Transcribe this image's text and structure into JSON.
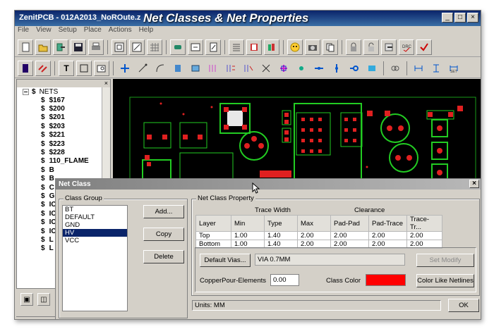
{
  "window": {
    "app_title": "ZenitPCB - 012A2013_NoROute.z",
    "overlay_title": "Net Classes & Net Properties",
    "controls": [
      "_",
      "□",
      "×"
    ]
  },
  "menu": [
    "File",
    "View",
    "Setup",
    "Place",
    "Actions",
    "Help"
  ],
  "sidebar": {
    "close": "×",
    "root_label": "NETS",
    "items": [
      "$167",
      "$200",
      "$201",
      "$203",
      "$221",
      "$223",
      "$228",
      "110_FLAME",
      "B",
      "B",
      "C",
      "G",
      "IC",
      "IC",
      "IC",
      "IC",
      "L",
      "L"
    ]
  },
  "dialog": {
    "title": "Net Class",
    "close": "×",
    "class_group": {
      "label": "Class Group",
      "items": [
        "BT",
        "DEFAULT",
        "GND",
        "HV",
        "VCC"
      ],
      "selected": "HV",
      "add_label": "Add...",
      "copy_label": "Copy",
      "delete_label": "Delete"
    },
    "property": {
      "label": "Net Class Property",
      "trace_width_label": "Trace Width",
      "clearance_label": "Clearance",
      "columns": [
        "Layer",
        "Min",
        "Type",
        "Max",
        "Pad-Pad",
        "Pad-Trace",
        "Trace-Tr..."
      ],
      "rows": [
        [
          "Top",
          "1.00",
          "1.40",
          "2.00",
          "2.00",
          "2.00",
          "2.00"
        ],
        [
          "Bottom",
          "1.00",
          "1.40",
          "2.00",
          "2.00",
          "2.00",
          "2.00"
        ]
      ],
      "default_vias_label": "Default Vias...",
      "vias_value": "VIA 0.7MM",
      "set_modify_label": "Set Modify",
      "copper_pour_label": "CopperPour-Elements",
      "copper_pour_value": "0.00",
      "class_color_label": "Class Color",
      "class_color": "#ff0000",
      "color_like_label": "Color Like Netlines"
    },
    "units": "Units:  MM",
    "ok_label": "OK"
  },
  "colors": {
    "pcb_background": "#000000",
    "trace_green": "#22cc22",
    "pad_red": "#e02020",
    "title_blue": "#0a246a"
  }
}
